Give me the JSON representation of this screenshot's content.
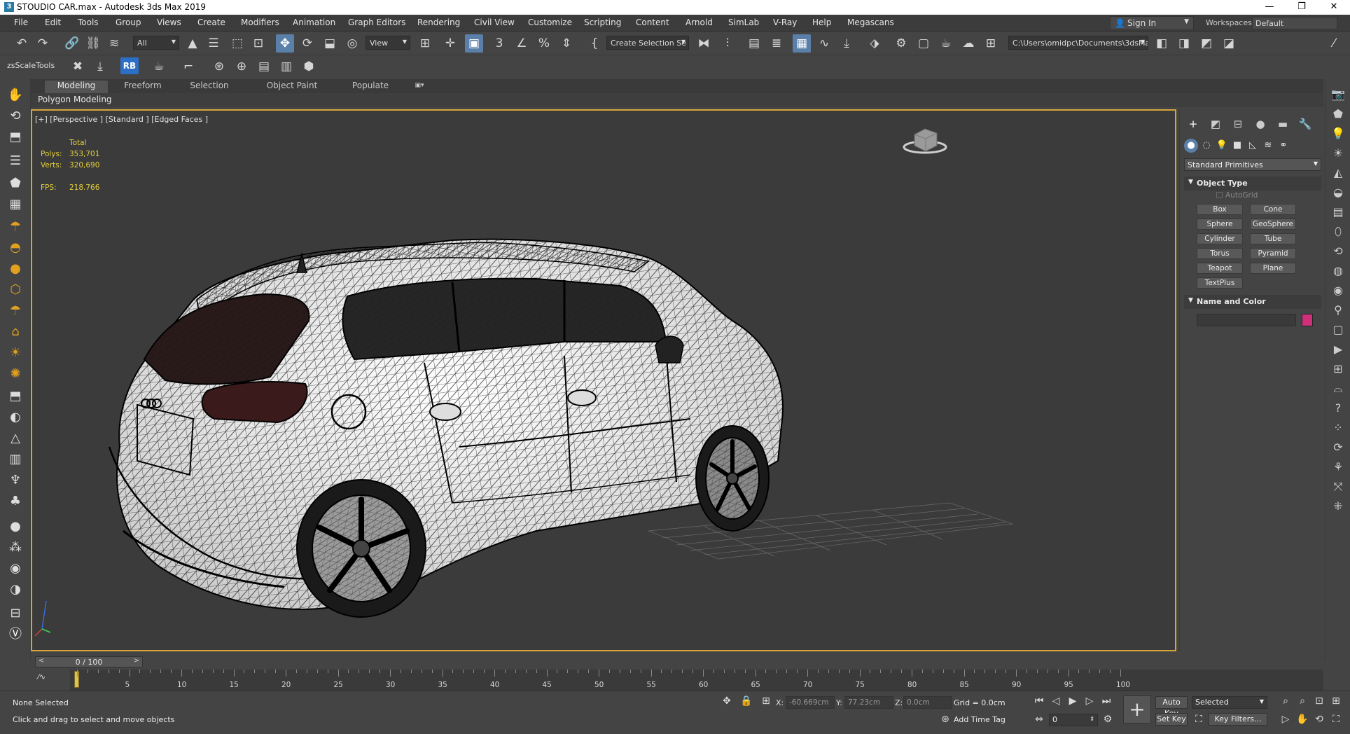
{
  "window": {
    "title": "STOUDIO  CAR.max - Autodesk 3ds Max 2019",
    "app_icon": "3",
    "min": "—",
    "max": "❐",
    "close": "✕"
  },
  "menu": [
    "File",
    "Edit",
    "Tools",
    "Group",
    "Views",
    "Create",
    "Modifiers",
    "Animation",
    "Graph Editors",
    "Rendering",
    "Civil View",
    "Customize",
    "Scripting",
    "Content",
    "Arnold",
    "SimLab",
    "V-Ray",
    "Help",
    "Megascans"
  ],
  "account": {
    "sign_in": "Sign In",
    "workspaces_label": "Workspaces:",
    "workspace": "Default"
  },
  "toolbar": {
    "selection_filter": "All",
    "ref_coord": "View",
    "named_selection": "Create Selection Se",
    "project_path": "C:\\Users\\omidpc\\Documents\\3dsMax",
    "zs_label": "zsScaleTools",
    "rb_label": "RB"
  },
  "ribbon": {
    "tabs": [
      "Modeling",
      "Freeform",
      "Selection",
      "Object Paint",
      "Populate"
    ],
    "active_tab": "Modeling",
    "panel_label": "Polygon Modeling"
  },
  "viewport": {
    "label": "[+] [Perspective ] [Standard ] [Edged Faces ]",
    "stats": {
      "header": "Total",
      "polys_label": "Polys:",
      "polys": "353,701",
      "verts_label": "Verts:",
      "verts": "320,690",
      "fps_label": "FPS:",
      "fps": "218.766"
    }
  },
  "command_panel": {
    "category": "Standard Primitives",
    "object_type_title": "Object Type",
    "autogrid": "AutoGrid",
    "primitives": [
      "Box",
      "Cone",
      "Sphere",
      "GeoSphere",
      "Cylinder",
      "Tube",
      "Torus",
      "Pyramid",
      "Teapot",
      "Plane",
      "TextPlus"
    ],
    "name_color_title": "Name and Color",
    "object_color": "#d0307a"
  },
  "timeline": {
    "frame_display": "0 / 100",
    "ticks": [
      "5",
      "10",
      "15",
      "20",
      "25",
      "30",
      "35",
      "40",
      "45",
      "50",
      "55",
      "60",
      "65",
      "70",
      "75",
      "80",
      "85",
      "90",
      "95",
      "100"
    ]
  },
  "status": {
    "selection": "None Selected",
    "prompt": "Click and drag to select and move objects",
    "x_label": "X:",
    "x": "-60.669cm",
    "y_label": "Y:",
    "y": "77.23cm",
    "z_label": "Z:",
    "z": "0.0cm",
    "grid": "Grid = 0.0cm",
    "add_time_tag": "Add Time Tag",
    "auto_key": "Auto Key",
    "set_key": "Set Key",
    "key_mode": "Selected",
    "key_filters": "Key Filters...",
    "frame": "0"
  },
  "colors": {
    "viewport_border": "#d7a53b",
    "stats_text": "#e4cf3a",
    "active_tool": "#5a7fa8"
  }
}
